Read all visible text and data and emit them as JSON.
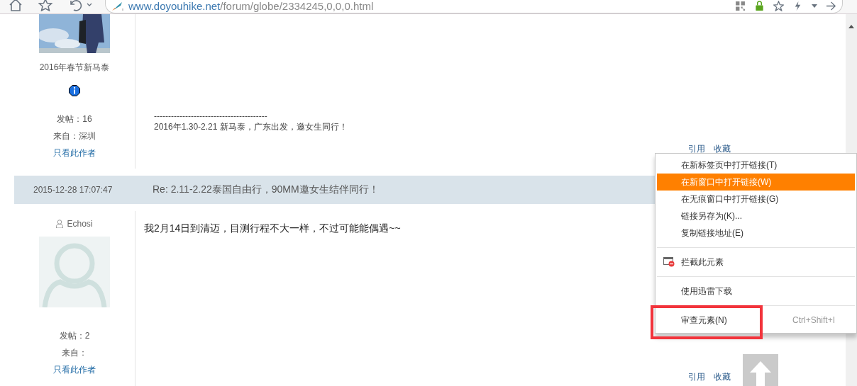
{
  "toolbar": {
    "address": {
      "host": "www.doyouhike.net",
      "path": "/forum/globe/2334245,0,0,0.html"
    }
  },
  "posts": [
    {
      "user_title": "2016年春节新马泰",
      "info_badge": true,
      "stats": [
        "发帖：16",
        "来自：深圳"
      ],
      "author_link": "只看此作者",
      "signature_rule": "----------------------------------------",
      "signature": "2016年1.30-2.21 新马泰，广东出发，邀女生同行！",
      "actions": [
        "引用",
        "收藏"
      ]
    },
    {
      "header": {
        "date": "2015-12-28 17:07:47",
        "subject": "Re: 2.11-2.22泰国自由行，90MM邀女生结伴同行！"
      },
      "username": "Echosi",
      "avatar": {
        "kind": "default"
      },
      "stats": [
        "发帖：2",
        "来自："
      ],
      "author_link": "只看此作者",
      "body": "我2月14日到清迈，目测行程不大一样，不过可能能偶遇~~",
      "actions": [
        "引用",
        "收藏"
      ]
    }
  ],
  "context_menu": {
    "items": [
      {
        "kind": "item",
        "label": "在新标签页中打开链接(T)",
        "selected": false
      },
      {
        "kind": "item",
        "label": "在新窗口中打开链接(W)",
        "selected": true
      },
      {
        "kind": "item",
        "label": "在无痕窗口中打开链接(G)",
        "selected": false
      },
      {
        "kind": "item",
        "label": "链接另存为(K)...",
        "selected": false
      },
      {
        "kind": "item",
        "label": "复制链接地址(E)",
        "selected": false
      },
      {
        "kind": "separator"
      },
      {
        "kind": "block",
        "label": "拦截此元素",
        "selected": false
      },
      {
        "kind": "separator"
      },
      {
        "kind": "item",
        "label": "使用迅雷下载",
        "selected": false
      },
      {
        "kind": "separator"
      },
      {
        "kind": "item",
        "label": "审查元素(N)",
        "shortcut": "Ctrl+Shift+I",
        "selected": false,
        "annotated": true
      }
    ]
  }
}
